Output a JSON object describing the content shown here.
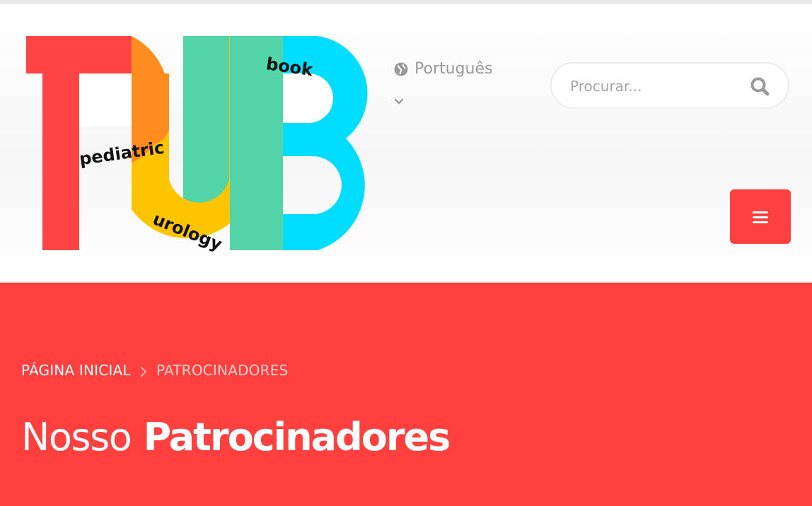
{
  "brand": {
    "logo_letters": "PUB",
    "logo_words": [
      "pediatric",
      "urology",
      "book"
    ]
  },
  "language": {
    "label": "Português",
    "icon": "globe-icon",
    "chevron": "chevron-down-icon"
  },
  "search": {
    "placeholder": "Procurar...",
    "icon": "search-icon"
  },
  "menu": {
    "icon": "hamburger-menu-icon"
  },
  "breadcrumb": {
    "home": "PÁGINA INICIAL",
    "separator_icon": "chevron-right-icon",
    "current": "PATROCINADORES"
  },
  "page": {
    "title_light": "Nosso",
    "title_bold": "Patrocinadores"
  },
  "colors": {
    "accent": "#ff403e",
    "logo_red": "#ff4444",
    "logo_orange": "#ff8c1e",
    "logo_yellow": "#ffc400",
    "logo_green": "#52d3a8",
    "logo_cyan": "#00ddff"
  }
}
